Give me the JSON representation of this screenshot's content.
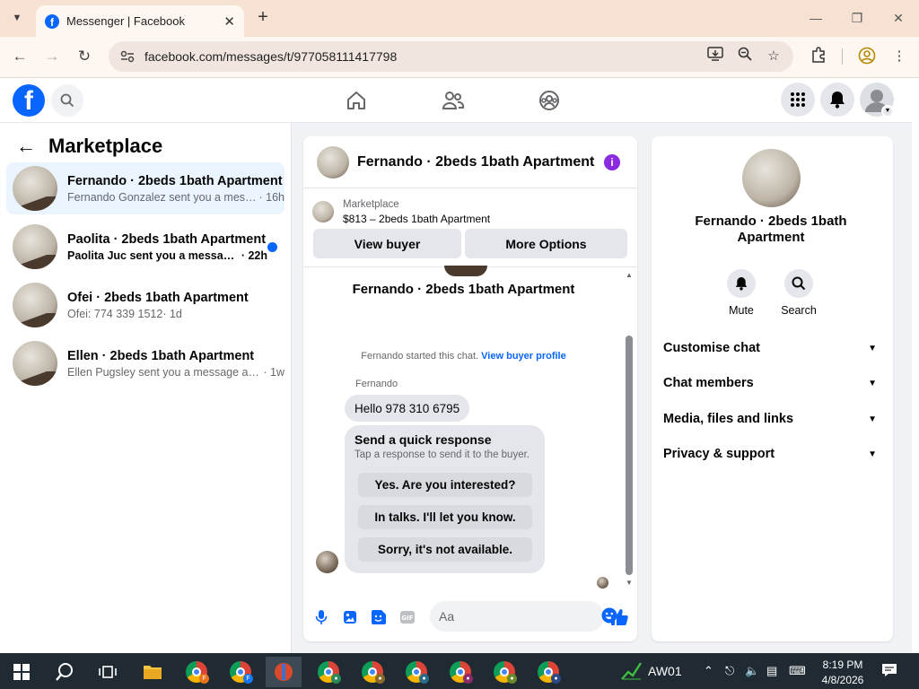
{
  "browser": {
    "tab_title": "Messenger | Facebook",
    "url": "facebook.com/messages/t/977058111417798"
  },
  "left_panel": {
    "title": "Marketplace",
    "conversations": [
      {
        "name": "Fernando · 2beds 1bath Apartment",
        "preview": "Fernando Gonzalez sent you a mess...",
        "time": " · 16h",
        "selected": true,
        "unread": false
      },
      {
        "name": "Paolita · 2beds 1bath Apartment",
        "preview": "Paolita Juc sent you a message a...",
        "time": " · 22h",
        "selected": false,
        "unread": true
      },
      {
        "name": "Ofei · 2beds 1bath Apartment",
        "preview": "Ofei: 774 339 1512",
        "time": " · 1d",
        "selected": false,
        "unread": false
      },
      {
        "name": "Ellen · 2beds 1bath Apartment",
        "preview": "Ellen Pugsley sent you a message abo...",
        "time": " · 1w",
        "selected": false,
        "unread": false
      }
    ]
  },
  "chat": {
    "header_name": "Fernando · 2beds 1bath Apartment",
    "marketplace_label": "Marketplace",
    "listing": "$813 – 2beds 1bath Apartment",
    "view_buyer": "View buyer",
    "more_options": "More Options",
    "big_name": "Fernando · 2beds 1bath Apartment",
    "started_text": "Fernando started this chat.",
    "view_buyer_profile": "View buyer profile",
    "sender": "Fernando",
    "message": "Hello 978 310  6795",
    "quick_title": "Send a quick response",
    "quick_subtitle": "Tap a response to send it to the buyer.",
    "quick_responses": [
      "Yes. Are you interested?",
      "In talks. I'll let you know.",
      "Sorry, it's not available."
    ],
    "composer_placeholder": "Aa"
  },
  "right_panel": {
    "name": "Fernando · 2beds 1bath Apartment",
    "mute": "Mute",
    "search": "Search",
    "sections": [
      "Customise chat",
      "Chat members",
      "Media, files and links",
      "Privacy & support"
    ]
  },
  "taskbar": {
    "aw_label": "AW01",
    "time": "8:19 PM",
    "date": "4/8/2026"
  },
  "colors": {
    "fb_blue": "#0866ff",
    "info_purple": "#8a2be2",
    "taskbar": "#1f2a33",
    "tab_strip": "#f6e1d3"
  }
}
